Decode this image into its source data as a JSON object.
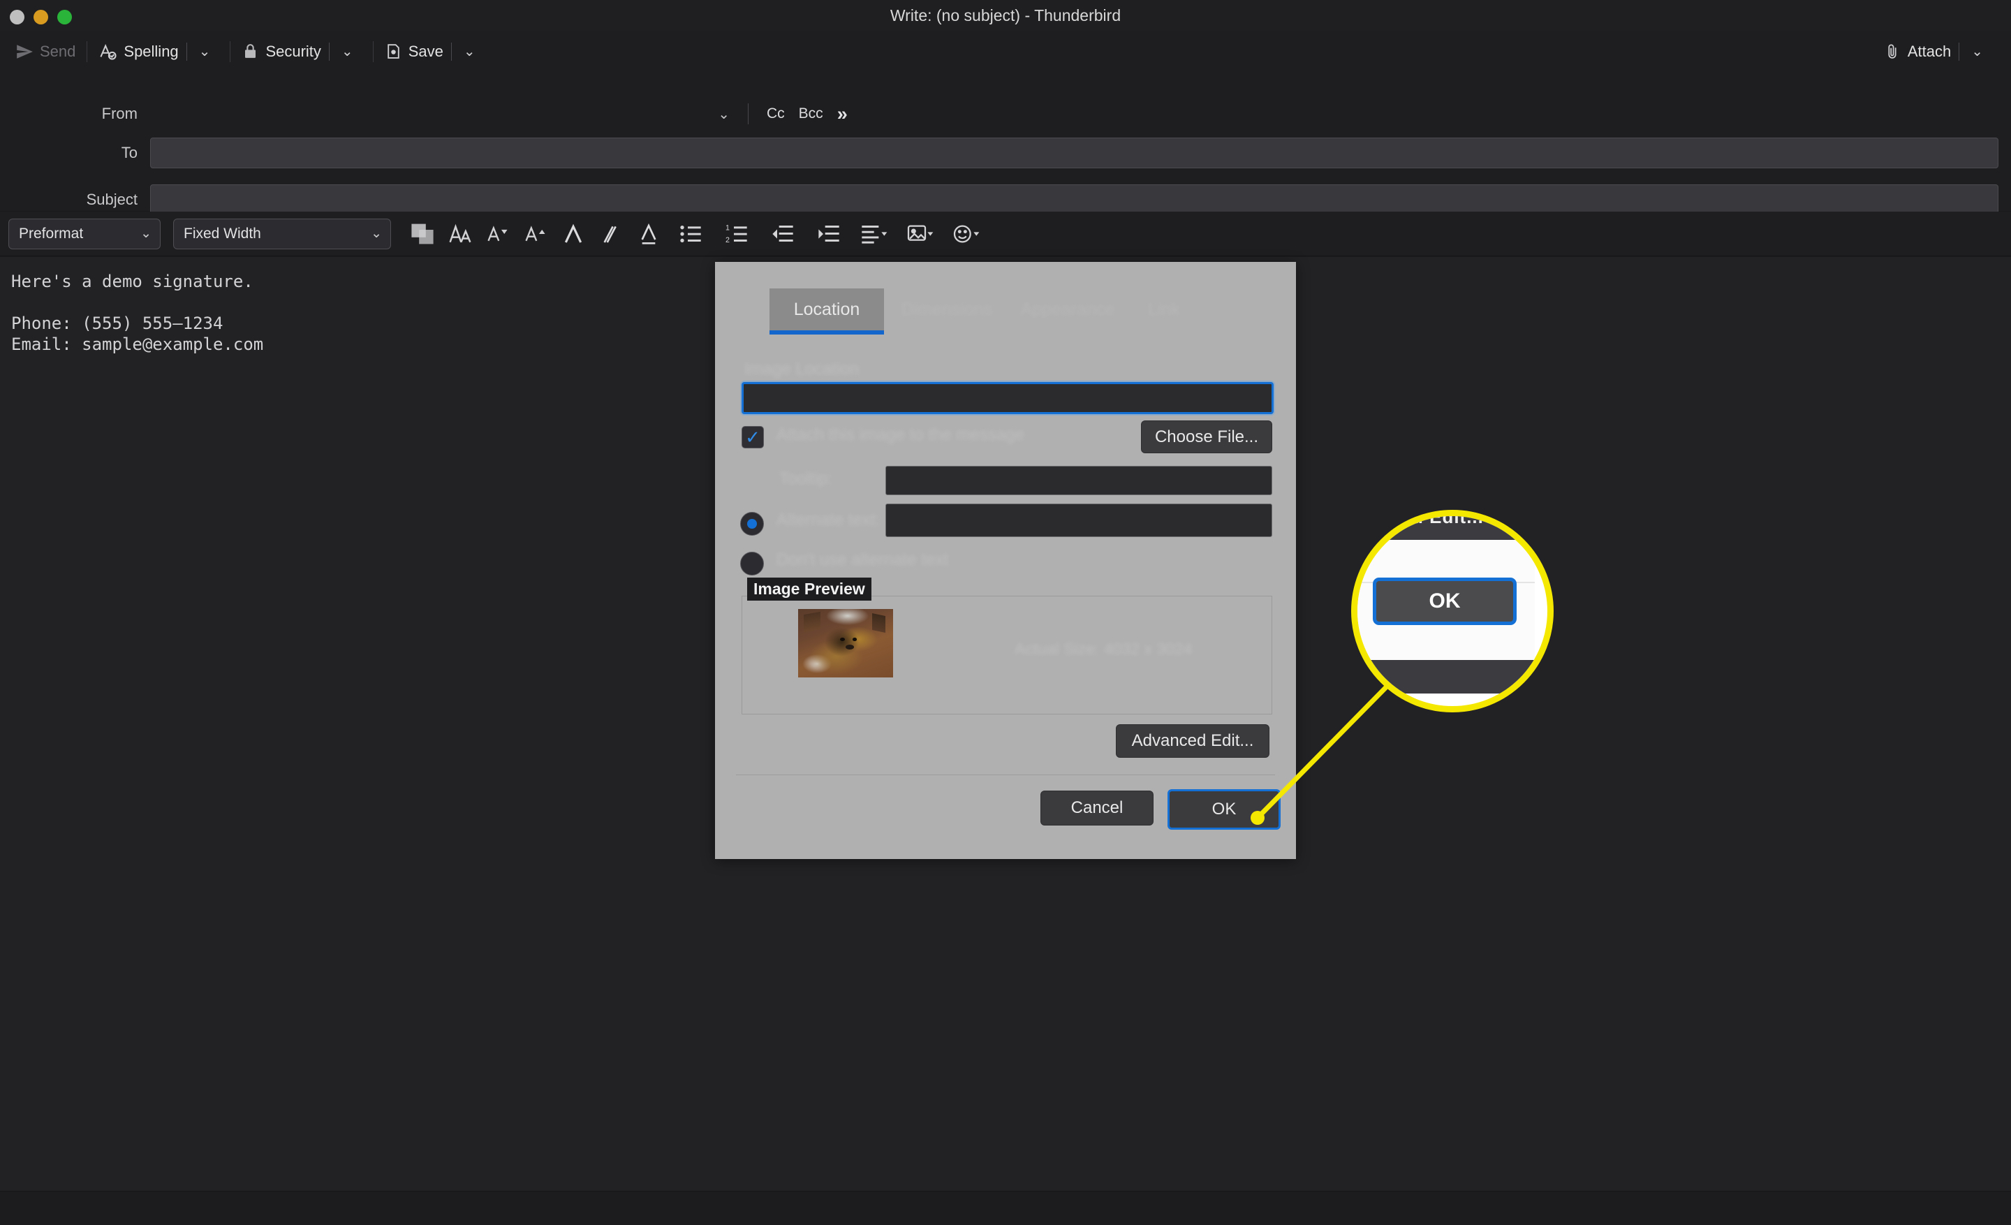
{
  "window": {
    "title": "Write: (no subject) - Thunderbird",
    "traffic_lights": [
      "close",
      "minimize",
      "zoom"
    ]
  },
  "toolbar": {
    "items": [
      {
        "label": "Send",
        "icon": "send-icon",
        "disabled": true,
        "has_caret": false
      },
      {
        "label": "Spelling",
        "icon": "spelling-icon",
        "disabled": false,
        "has_caret": true
      },
      {
        "label": "Security",
        "icon": "lock-icon",
        "disabled": false,
        "has_caret": true
      },
      {
        "label": "Save",
        "icon": "save-icon",
        "disabled": false,
        "has_caret": true
      }
    ],
    "attach": {
      "label": "Attach",
      "icon": "paperclip-icon",
      "has_caret": true
    }
  },
  "addressing": {
    "from_label": "From",
    "from_value": "",
    "cc_label": "Cc",
    "bcc_label": "Bcc",
    "more_label": "»",
    "to_label": "To",
    "to_value": "",
    "subject_label": "Subject",
    "subject_value": ""
  },
  "format_toolbar": {
    "paragraph_style": "Preformat",
    "font_family": "Fixed Width",
    "icons": [
      "text-color-icon",
      "font-size-icon",
      "decrease-font-size-icon",
      "increase-font-size-icon",
      "bold-icon",
      "italic-icon",
      "underline-icon",
      "bullet-list-icon",
      "numbered-list-icon",
      "decrease-indent-icon",
      "increase-indent-icon",
      "align-icon",
      "insert-image-icon",
      "emoji-icon"
    ]
  },
  "message_body": {
    "text": "Here's a demo signature.\n\nPhone: (555) 555–1234\nEmail: sample@example.com"
  },
  "dialog": {
    "tabs": [
      {
        "label": "Location",
        "active": true
      },
      {
        "label": "Dimensions",
        "active": false
      },
      {
        "label": "Appearance",
        "active": false
      },
      {
        "label": "Link",
        "active": false
      }
    ],
    "image_location_label": "Image Location",
    "image_location_value": "",
    "attach_checkbox_label": "Attach this image to the message",
    "attach_checkbox_checked": true,
    "choose_file_label": "Choose File...",
    "tooltip_label": "Tooltip:",
    "tooltip_value": "",
    "alternate_text_label": "Alternate text:",
    "alternate_text_value": "",
    "alternate_text_selected": true,
    "no_alternate_text_label": "Don't use alternate text",
    "no_alternate_text_selected": false,
    "preview_legend": "Image Preview",
    "preview_dimensions": "Actual Size:  4032 x 3024",
    "advanced_edit_label": "Advanced Edit...",
    "cancel_label": "Cancel",
    "ok_label": "OK"
  },
  "callout": {
    "magnified_label": "OK",
    "partial_top_label": "d Edit...",
    "ring_color": "#f5e800",
    "focus_color": "#1470d4"
  },
  "colors": {
    "window_bg": "#1c1c1f",
    "toolbar_bg": "#1e1e21",
    "body_bg": "#222225",
    "dialog_bg": "#b0b0b0",
    "accent": "#1470d4",
    "highlight": "#f5e800"
  }
}
